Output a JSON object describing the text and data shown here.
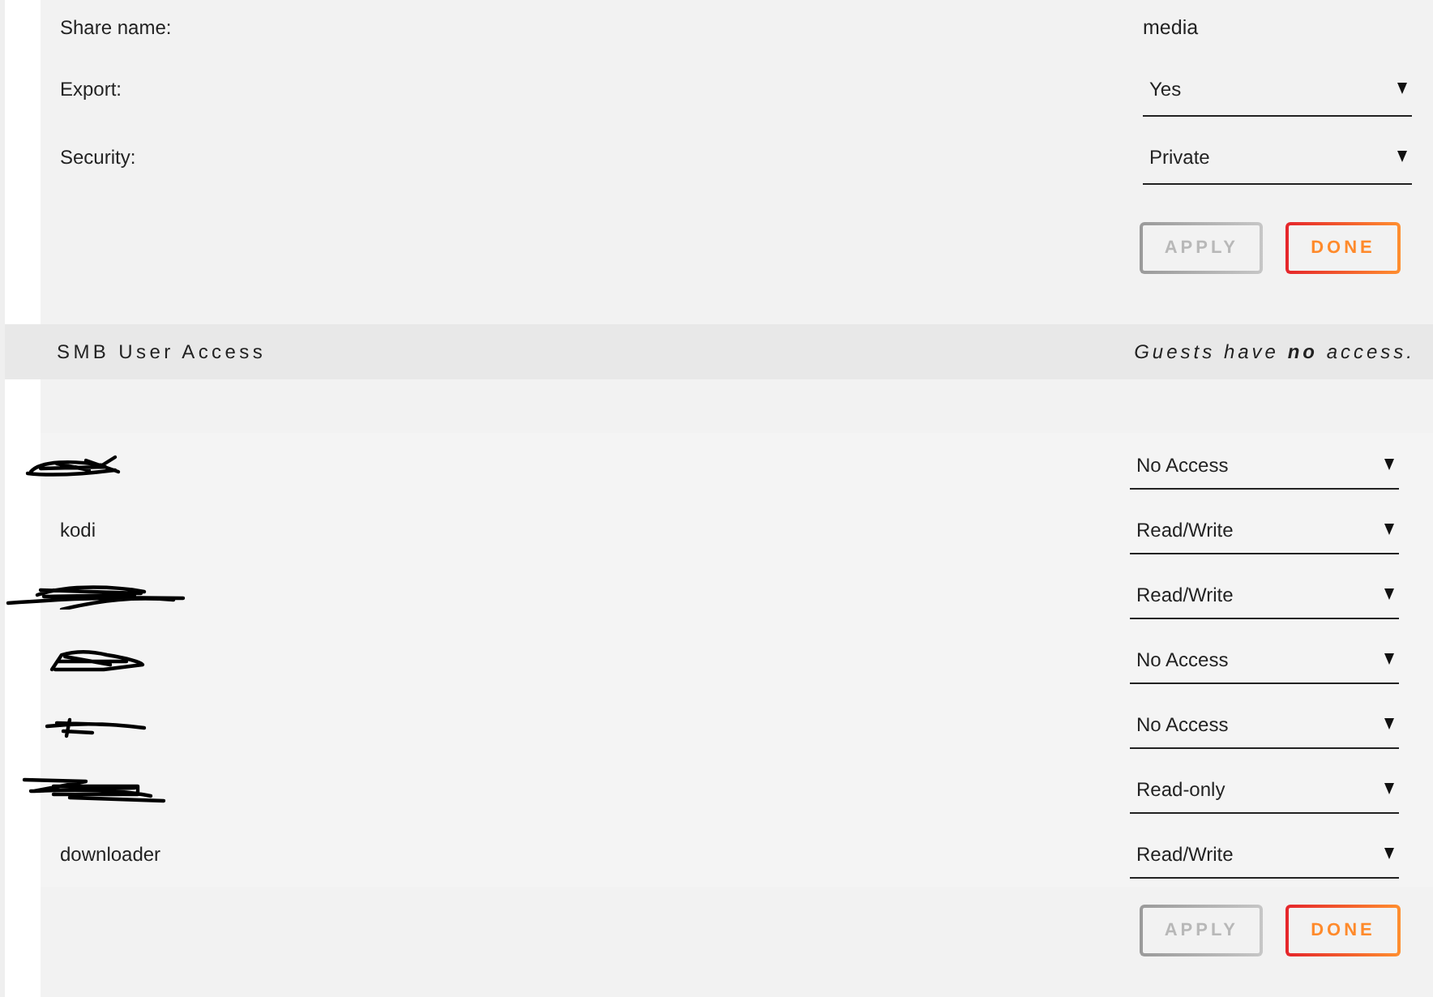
{
  "share_settings": {
    "fields": [
      {
        "label": "Share name:",
        "kind": "text",
        "value": "media"
      },
      {
        "label": "Export:",
        "kind": "dropdown",
        "value": "Yes"
      },
      {
        "label": "Security:",
        "kind": "dropdown",
        "value": "Private"
      }
    ],
    "buttons": [
      {
        "label": "APPLY",
        "disabled": true
      },
      {
        "label": "DONE",
        "disabled": false
      }
    ]
  },
  "user_access": {
    "title": "SMB User Access",
    "note": "Guests have **no** access.",
    "users": [
      {
        "kind": "redacted",
        "access": "No Access"
      },
      {
        "kind": "named",
        "name": "kodi",
        "access": "Read/Write"
      },
      {
        "kind": "redacted",
        "access": "Read/Write"
      },
      {
        "kind": "redacted",
        "access": "No Access"
      },
      {
        "kind": "redacted",
        "access": "No Access"
      },
      {
        "kind": "redacted",
        "access": "Read-only"
      },
      {
        "kind": "named",
        "name": "downloader",
        "access": "Read/Write"
      }
    ],
    "buttons": [
      {
        "label": "APPLY",
        "disabled": true
      },
      {
        "label": "DONE",
        "disabled": false
      }
    ]
  }
}
